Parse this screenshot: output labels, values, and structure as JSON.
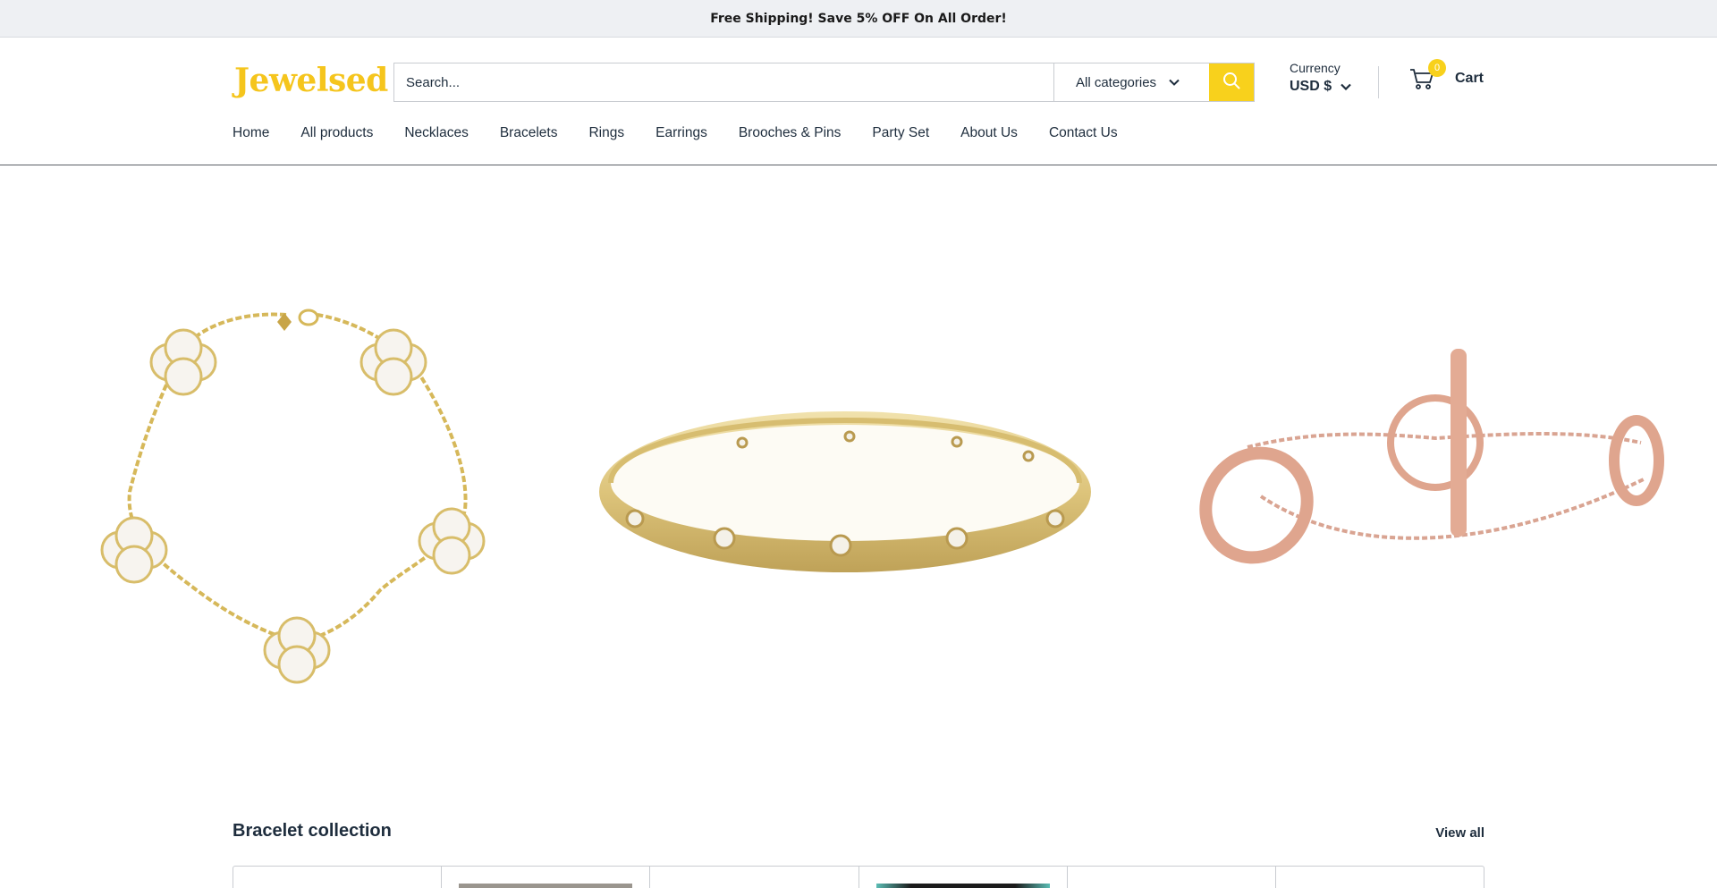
{
  "announcement": {
    "text": "Free Shipping! Save 5% OFF On All Order!"
  },
  "header": {
    "logo_text": "Jewelsed",
    "search": {
      "placeholder": "Search...",
      "category": "All categories"
    },
    "currency": {
      "label": "Currency",
      "value": "USD $"
    },
    "cart": {
      "count": "0",
      "label": "Cart"
    }
  },
  "nav": {
    "items": [
      {
        "label": "Home"
      },
      {
        "label": "All products"
      },
      {
        "label": "Necklaces"
      },
      {
        "label": "Bracelets"
      },
      {
        "label": "Rings"
      },
      {
        "label": "Earrings"
      },
      {
        "label": "Brooches & Pins"
      },
      {
        "label": "Party Set"
      },
      {
        "label": "About Us"
      },
      {
        "label": "Contact Us"
      }
    ]
  },
  "section": {
    "title": "Bracelet collection",
    "view_all": "View all"
  },
  "colors": {
    "accent": "#f8d11c",
    "logo": "#f5c51d",
    "text": "#1e2d3d"
  }
}
